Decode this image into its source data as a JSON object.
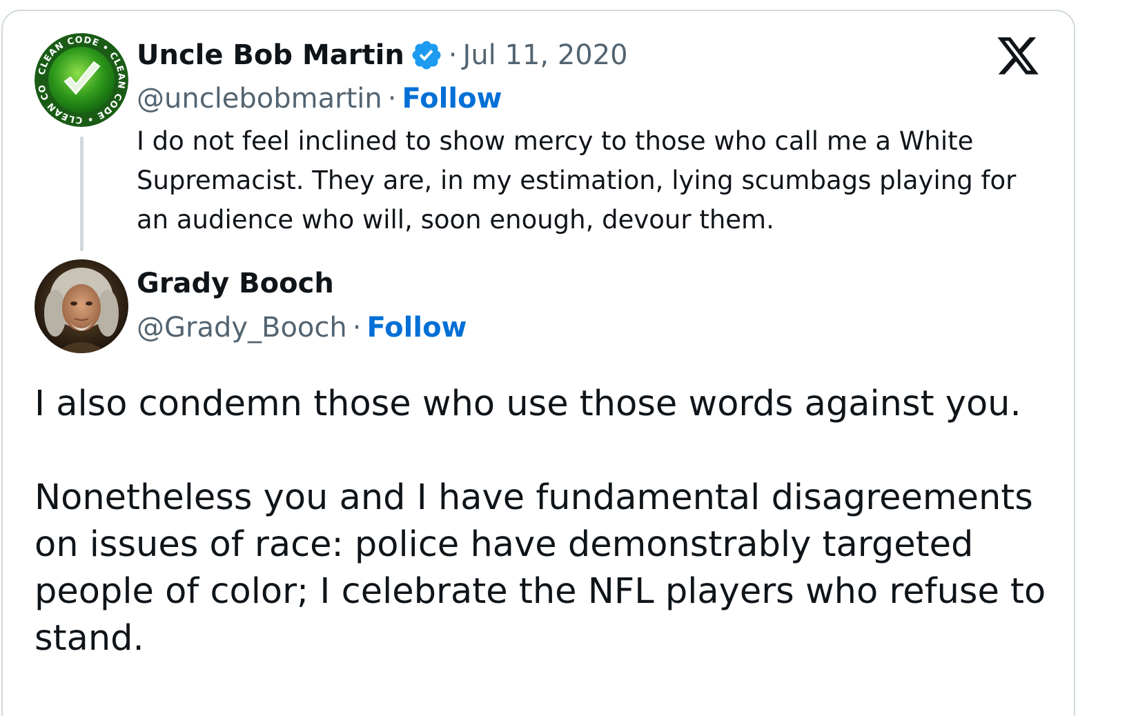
{
  "parent_tweet": {
    "display_name": "Uncle Bob Martin",
    "separator": "·",
    "date": "Jul 11, 2020",
    "handle": "@unclebobmartin",
    "follow_label": "Follow",
    "avatar_badge_text": "CLEAN CODE",
    "text": "I do not feel inclined to show mercy to those who call me a White Supremacist.  They are, in my estimation, lying scumbags playing for an audience who will, soon enough, devour them."
  },
  "tweet": {
    "display_name": "Grady Booch",
    "separator": "·",
    "handle": "@Grady_Booch",
    "follow_label": "Follow",
    "text_para1": "I also condemn those who use those words against you.",
    "text_para2": "Nonetheless you and I have fundamental disagreements on issues of race: police have demonstrably targeted people of color; I celebrate the NFL players who refuse to stand."
  },
  "icons": {
    "brand": "x-logo-icon",
    "verified": "verified-badge-icon"
  },
  "colors": {
    "link_blue": "#006fd6",
    "verified_blue": "#1d9bf0",
    "muted_gray": "#536471",
    "border_gray": "#cfd9de",
    "text_dark": "#0f1419"
  }
}
